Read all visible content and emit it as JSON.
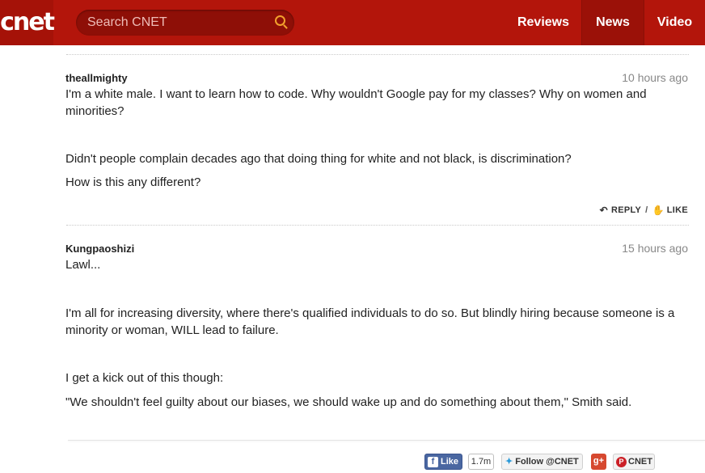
{
  "header": {
    "logo_text": "cnet",
    "search_placeholder": "Search CNET",
    "nav": [
      {
        "label": "Reviews"
      },
      {
        "label": "News"
      },
      {
        "label": "Video"
      }
    ],
    "brand_color": "#b3150b",
    "search_icon_color": "#f2a12d"
  },
  "comments": [
    {
      "username": "theallmighty",
      "timestamp": "10 hours ago",
      "paragraphs": [
        "I'm a white male. I want to learn how to code. Why wouldn't Google pay for my classes? Why on women and minorities?",
        "Didn't people complain decades ago that doing thing for white and not black, is discrimination?",
        "How is this any different?"
      ],
      "actions": {
        "reply": "REPLY",
        "separator": "/",
        "like": "LIKE"
      }
    },
    {
      "username": "Kungpaoshizi",
      "timestamp": "15 hours ago",
      "paragraphs": [
        "Lawl...",
        "I'm all for increasing diversity, where there's qualified individuals to do so. But blindly hiring because someone is a minority or woman, WILL lead to failure.",
        "I get a kick out of this though:",
        "\"We shouldn't feel guilty about our biases, we should wake up and do something about them,\" Smith said."
      ]
    }
  ],
  "social_bar": {
    "fb_like": "Like",
    "fb_count": "1.7m",
    "twitter_follow": "Follow @CNET",
    "gplus": "g+",
    "pinterest_follow": "CNET"
  }
}
